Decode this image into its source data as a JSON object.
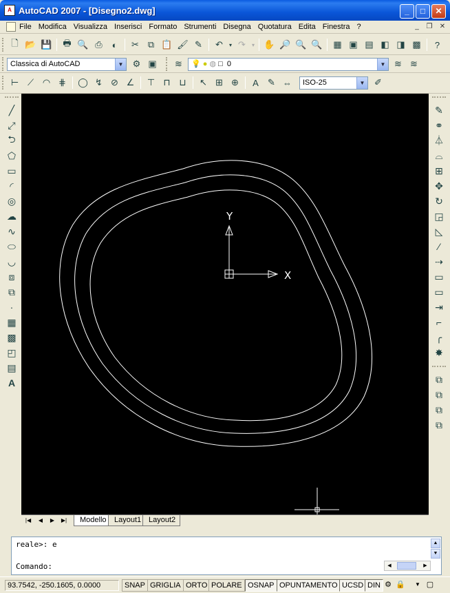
{
  "window": {
    "title": "AutoCAD 2007 - [Disegno2.dwg]",
    "app_icon_text": "A"
  },
  "menu": [
    "File",
    "Modifica",
    "Visualizza",
    "Inserisci",
    "Formato",
    "Strumenti",
    "Disegna",
    "Quotatura",
    "Edita",
    "Finestra",
    "?"
  ],
  "workspace": {
    "value": "Classica di AutoCAD"
  },
  "layer": {
    "value": "0"
  },
  "dimstyle": {
    "value": "ISO-25"
  },
  "canvas": {
    "background": "#000000",
    "ucs_y_label": "Y",
    "ucs_x_label": "X"
  },
  "tabs": [
    "Modello",
    "Layout1",
    "Layout2"
  ],
  "command_line": {
    "history": "reale>: e",
    "prompt": "Comando:"
  },
  "status": {
    "coordinates": "93.7542,  -250.1605, 0.0000",
    "toggles": [
      "SNAP",
      "GRIGLIA",
      "ORTO",
      "POLARE",
      "OSNAP",
      "OPUNTAMENTO",
      "UCSD",
      "DIN"
    ],
    "active_toggles": [
      "OSNAP",
      "OPUNTAMENTO",
      "UCSD",
      "DIN"
    ]
  }
}
